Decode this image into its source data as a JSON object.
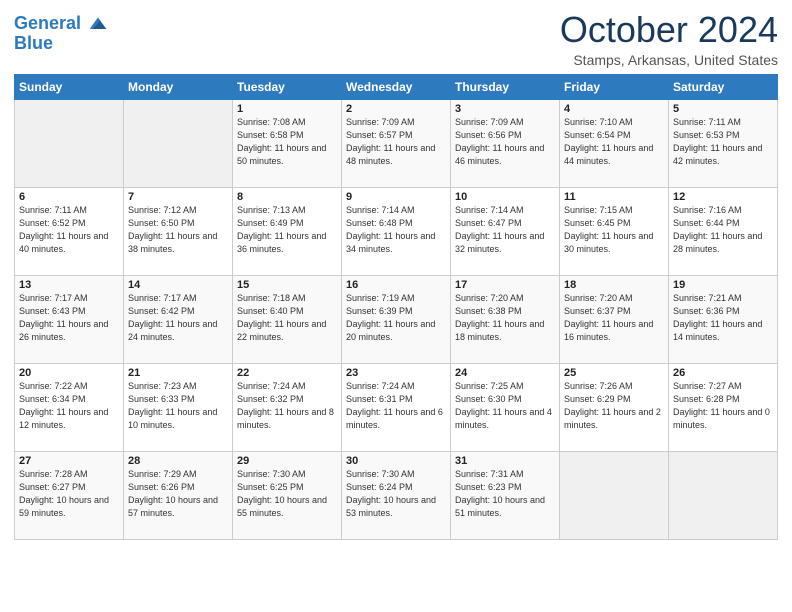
{
  "header": {
    "logo_line1": "General",
    "logo_line2": "Blue",
    "month": "October 2024",
    "location": "Stamps, Arkansas, United States"
  },
  "weekdays": [
    "Sunday",
    "Monday",
    "Tuesday",
    "Wednesday",
    "Thursday",
    "Friday",
    "Saturday"
  ],
  "weeks": [
    [
      {
        "day": "",
        "sunrise": "",
        "sunset": "",
        "daylight": ""
      },
      {
        "day": "",
        "sunrise": "",
        "sunset": "",
        "daylight": ""
      },
      {
        "day": "1",
        "sunrise": "Sunrise: 7:08 AM",
        "sunset": "Sunset: 6:58 PM",
        "daylight": "Daylight: 11 hours and 50 minutes."
      },
      {
        "day": "2",
        "sunrise": "Sunrise: 7:09 AM",
        "sunset": "Sunset: 6:57 PM",
        "daylight": "Daylight: 11 hours and 48 minutes."
      },
      {
        "day": "3",
        "sunrise": "Sunrise: 7:09 AM",
        "sunset": "Sunset: 6:56 PM",
        "daylight": "Daylight: 11 hours and 46 minutes."
      },
      {
        "day": "4",
        "sunrise": "Sunrise: 7:10 AM",
        "sunset": "Sunset: 6:54 PM",
        "daylight": "Daylight: 11 hours and 44 minutes."
      },
      {
        "day": "5",
        "sunrise": "Sunrise: 7:11 AM",
        "sunset": "Sunset: 6:53 PM",
        "daylight": "Daylight: 11 hours and 42 minutes."
      }
    ],
    [
      {
        "day": "6",
        "sunrise": "Sunrise: 7:11 AM",
        "sunset": "Sunset: 6:52 PM",
        "daylight": "Daylight: 11 hours and 40 minutes."
      },
      {
        "day": "7",
        "sunrise": "Sunrise: 7:12 AM",
        "sunset": "Sunset: 6:50 PM",
        "daylight": "Daylight: 11 hours and 38 minutes."
      },
      {
        "day": "8",
        "sunrise": "Sunrise: 7:13 AM",
        "sunset": "Sunset: 6:49 PM",
        "daylight": "Daylight: 11 hours and 36 minutes."
      },
      {
        "day": "9",
        "sunrise": "Sunrise: 7:14 AM",
        "sunset": "Sunset: 6:48 PM",
        "daylight": "Daylight: 11 hours and 34 minutes."
      },
      {
        "day": "10",
        "sunrise": "Sunrise: 7:14 AM",
        "sunset": "Sunset: 6:47 PM",
        "daylight": "Daylight: 11 hours and 32 minutes."
      },
      {
        "day": "11",
        "sunrise": "Sunrise: 7:15 AM",
        "sunset": "Sunset: 6:45 PM",
        "daylight": "Daylight: 11 hours and 30 minutes."
      },
      {
        "day": "12",
        "sunrise": "Sunrise: 7:16 AM",
        "sunset": "Sunset: 6:44 PM",
        "daylight": "Daylight: 11 hours and 28 minutes."
      }
    ],
    [
      {
        "day": "13",
        "sunrise": "Sunrise: 7:17 AM",
        "sunset": "Sunset: 6:43 PM",
        "daylight": "Daylight: 11 hours and 26 minutes."
      },
      {
        "day": "14",
        "sunrise": "Sunrise: 7:17 AM",
        "sunset": "Sunset: 6:42 PM",
        "daylight": "Daylight: 11 hours and 24 minutes."
      },
      {
        "day": "15",
        "sunrise": "Sunrise: 7:18 AM",
        "sunset": "Sunset: 6:40 PM",
        "daylight": "Daylight: 11 hours and 22 minutes."
      },
      {
        "day": "16",
        "sunrise": "Sunrise: 7:19 AM",
        "sunset": "Sunset: 6:39 PM",
        "daylight": "Daylight: 11 hours and 20 minutes."
      },
      {
        "day": "17",
        "sunrise": "Sunrise: 7:20 AM",
        "sunset": "Sunset: 6:38 PM",
        "daylight": "Daylight: 11 hours and 18 minutes."
      },
      {
        "day": "18",
        "sunrise": "Sunrise: 7:20 AM",
        "sunset": "Sunset: 6:37 PM",
        "daylight": "Daylight: 11 hours and 16 minutes."
      },
      {
        "day": "19",
        "sunrise": "Sunrise: 7:21 AM",
        "sunset": "Sunset: 6:36 PM",
        "daylight": "Daylight: 11 hours and 14 minutes."
      }
    ],
    [
      {
        "day": "20",
        "sunrise": "Sunrise: 7:22 AM",
        "sunset": "Sunset: 6:34 PM",
        "daylight": "Daylight: 11 hours and 12 minutes."
      },
      {
        "day": "21",
        "sunrise": "Sunrise: 7:23 AM",
        "sunset": "Sunset: 6:33 PM",
        "daylight": "Daylight: 11 hours and 10 minutes."
      },
      {
        "day": "22",
        "sunrise": "Sunrise: 7:24 AM",
        "sunset": "Sunset: 6:32 PM",
        "daylight": "Daylight: 11 hours and 8 minutes."
      },
      {
        "day": "23",
        "sunrise": "Sunrise: 7:24 AM",
        "sunset": "Sunset: 6:31 PM",
        "daylight": "Daylight: 11 hours and 6 minutes."
      },
      {
        "day": "24",
        "sunrise": "Sunrise: 7:25 AM",
        "sunset": "Sunset: 6:30 PM",
        "daylight": "Daylight: 11 hours and 4 minutes."
      },
      {
        "day": "25",
        "sunrise": "Sunrise: 7:26 AM",
        "sunset": "Sunset: 6:29 PM",
        "daylight": "Daylight: 11 hours and 2 minutes."
      },
      {
        "day": "26",
        "sunrise": "Sunrise: 7:27 AM",
        "sunset": "Sunset: 6:28 PM",
        "daylight": "Daylight: 11 hours and 0 minutes."
      }
    ],
    [
      {
        "day": "27",
        "sunrise": "Sunrise: 7:28 AM",
        "sunset": "Sunset: 6:27 PM",
        "daylight": "Daylight: 10 hours and 59 minutes."
      },
      {
        "day": "28",
        "sunrise": "Sunrise: 7:29 AM",
        "sunset": "Sunset: 6:26 PM",
        "daylight": "Daylight: 10 hours and 57 minutes."
      },
      {
        "day": "29",
        "sunrise": "Sunrise: 7:30 AM",
        "sunset": "Sunset: 6:25 PM",
        "daylight": "Daylight: 10 hours and 55 minutes."
      },
      {
        "day": "30",
        "sunrise": "Sunrise: 7:30 AM",
        "sunset": "Sunset: 6:24 PM",
        "daylight": "Daylight: 10 hours and 53 minutes."
      },
      {
        "day": "31",
        "sunrise": "Sunrise: 7:31 AM",
        "sunset": "Sunset: 6:23 PM",
        "daylight": "Daylight: 10 hours and 51 minutes."
      },
      {
        "day": "",
        "sunrise": "",
        "sunset": "",
        "daylight": ""
      },
      {
        "day": "",
        "sunrise": "",
        "sunset": "",
        "daylight": ""
      }
    ]
  ]
}
